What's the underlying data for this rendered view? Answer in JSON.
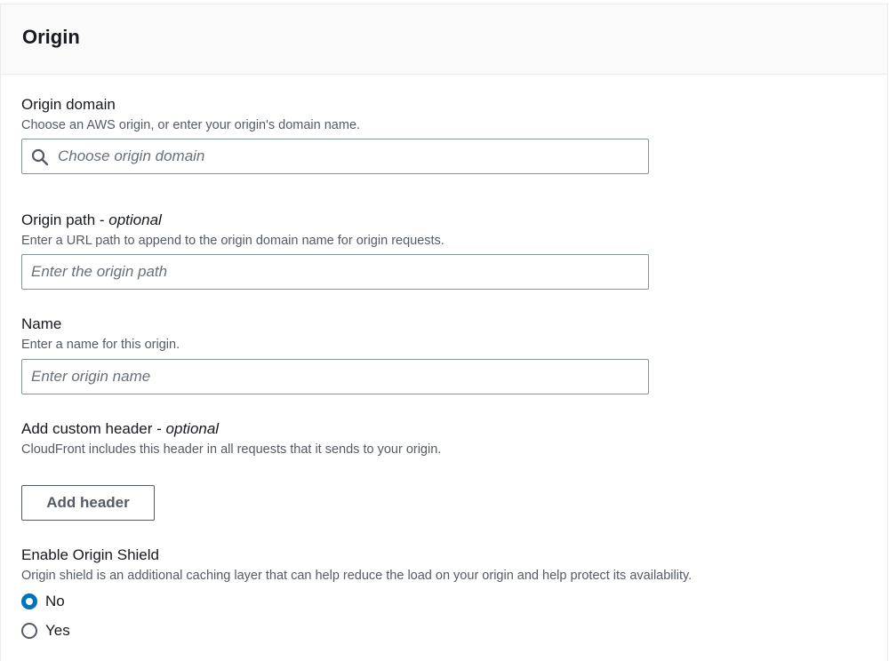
{
  "panel": {
    "title": "Origin"
  },
  "origin_domain": {
    "label": "Origin domain",
    "description": "Choose an AWS origin, or enter your origin's domain name.",
    "placeholder": "Choose origin domain",
    "value": ""
  },
  "origin_path": {
    "label": "Origin path - ",
    "label_optional": "optional",
    "description": "Enter a URL path to append to the origin domain name for origin requests.",
    "placeholder": "Enter the origin path",
    "value": ""
  },
  "name": {
    "label": "Name",
    "description": "Enter a name for this origin.",
    "placeholder": "Enter origin name",
    "value": ""
  },
  "custom_header": {
    "label": "Add custom header - ",
    "label_optional": "optional",
    "description": "CloudFront includes this header in all requests that it sends to your origin.",
    "button_label": "Add header"
  },
  "origin_shield": {
    "label": "Enable Origin Shield",
    "description": "Origin shield is an additional caching layer that can help reduce the load on your origin and help protect its availability.",
    "options": [
      {
        "label": "No",
        "selected": true
      },
      {
        "label": "Yes",
        "selected": false
      }
    ]
  },
  "colors": {
    "accent": "#0073bb",
    "header_bg": "#fafafa",
    "text": "#16191f",
    "secondary_text": "#545b64",
    "input_border": "#879596"
  },
  "icons": {
    "search": "search-icon"
  }
}
